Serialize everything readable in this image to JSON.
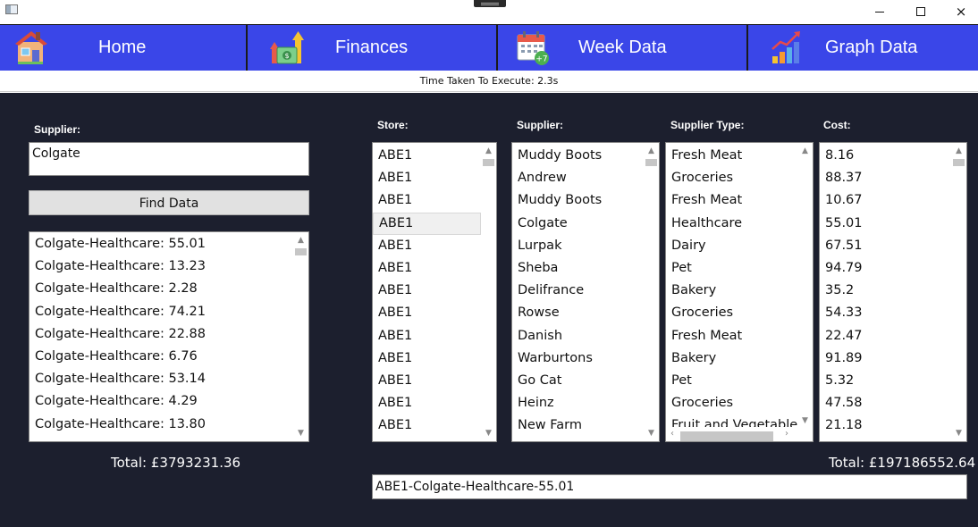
{
  "window": {
    "title_icon": "app-window-icon",
    "controls": {
      "minimize": "minimize-icon",
      "maximize": "maximize-icon",
      "close": "×"
    }
  },
  "nav": [
    {
      "label": "Home",
      "icon": "house-icon"
    },
    {
      "label": "Finances",
      "icon": "money-growth-icon"
    },
    {
      "label": "Week Data",
      "icon": "calendar-plus7-icon"
    },
    {
      "label": "Graph Data",
      "icon": "bar-chart-icon"
    }
  ],
  "status": {
    "time_taken": "Time Taken To Execute: 2.3s"
  },
  "left": {
    "supplier_label": "Supplier:",
    "supplier_value": "Colgate",
    "find_button": "Find Data",
    "results": [
      "Colgate-Healthcare: 55.01",
      "Colgate-Healthcare: 13.23",
      "Colgate-Healthcare: 2.28",
      "Colgate-Healthcare: 74.21",
      "Colgate-Healthcare: 22.88",
      "Colgate-Healthcare: 6.76",
      "Colgate-Healthcare: 53.14",
      "Colgate-Healthcare: 4.29",
      "Colgate-Healthcare: 13.80"
    ],
    "total": "Total: £3793231.36"
  },
  "right": {
    "headers": {
      "store": "Store:",
      "supplier": "Supplier:",
      "supplier_type": "Supplier Type:",
      "cost": "Cost:"
    },
    "stores": [
      "ABE1",
      "ABE1",
      "ABE1",
      "ABE1",
      "ABE1",
      "ABE1",
      "ABE1",
      "ABE1",
      "ABE1",
      "ABE1",
      "ABE1",
      "ABE1",
      "ABE1"
    ],
    "selected_store_index": 3,
    "suppliers": [
      "Muddy Boots",
      "Andrew",
      "Muddy Boots",
      "Colgate",
      "Lurpak",
      "Sheba",
      "Delifrance",
      "Rowse",
      "Danish",
      "Warburtons",
      "Go Cat",
      "Heinz",
      "New Farm"
    ],
    "supplier_types": [
      "Fresh Meat",
      "Groceries",
      "Fresh Meat",
      "Healthcare",
      "Dairy",
      "Pet",
      "Bakery",
      "Groceries",
      "Fresh Meat",
      "Bakery",
      "Pet",
      "Groceries",
      "Fruit and Vegetables"
    ],
    "costs": [
      "8.16",
      "88.37",
      "10.67",
      "55.01",
      "67.51",
      "94.79",
      "35.2",
      "54.33",
      "22.47",
      "91.89",
      "5.32",
      "47.58",
      "21.18"
    ],
    "total": "Total: £197186552.64",
    "selection_output": "ABE1-Colgate-Healthcare-55.01"
  }
}
